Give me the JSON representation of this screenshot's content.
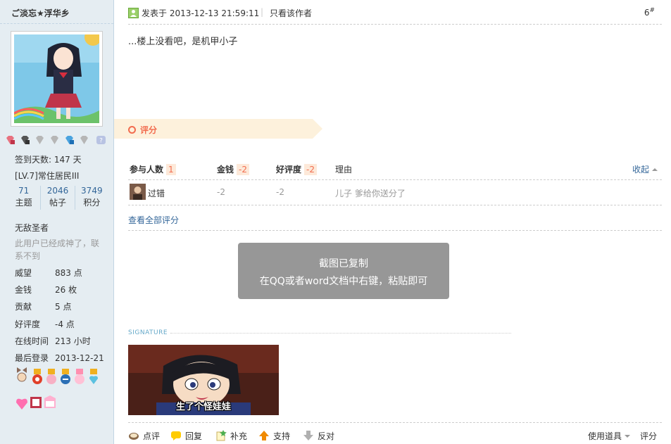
{
  "sidebar": {
    "username": "ご淡忘★浮华乡",
    "checkin": "签到天数: 147 天",
    "level": "[LV.7]常住居民III",
    "stats": [
      {
        "num": "71",
        "label": "主题"
      },
      {
        "num": "2046",
        "label": "帖子"
      },
      {
        "num": "3749",
        "label": "积分"
      }
    ],
    "title": "无敌圣者",
    "note": "此用户已经成神了，联系不到",
    "profile": [
      {
        "key": "威望",
        "value": "883 点"
      },
      {
        "key": "金钱",
        "value": "26 枚"
      },
      {
        "key": "贡献",
        "value": "5 点"
      },
      {
        "key": "好评度",
        "value": "-4 点"
      },
      {
        "key": "在线时间",
        "value": "213 小时"
      },
      {
        "key": "最后登录",
        "value": "2013-12-21"
      }
    ]
  },
  "post": {
    "posted_at": "发表于 2013-12-13 21:59:11",
    "only_author": "只看该作者",
    "floor": "6",
    "floor_mark": "#",
    "content": "...楼上没看吧，是机甲小子"
  },
  "rating": {
    "banner": "评分",
    "headers": {
      "participants": "参与人数",
      "participants_count": "1",
      "money": "金钱",
      "money_total": "-2",
      "reputation": "好评度",
      "reputation_total": "-2",
      "reason": "理由",
      "collapse": "收起"
    },
    "rows": [
      {
        "user": "过错",
        "money": "-2",
        "reputation": "-2",
        "reason": "儿子 爹给你送分了"
      }
    ],
    "view_all": "查看全部评分"
  },
  "toast": {
    "line1": "截图已复制",
    "line2": "在QQ或者word文档中右键，粘贴即可"
  },
  "signature": {
    "label": "SIGNATURE",
    "caption": "生了个怪娃娃"
  },
  "actions": {
    "comment": "点评",
    "reply": "回复",
    "supplement": "补充",
    "support": "支持",
    "oppose": "反对",
    "tools": "使用道具",
    "rate": "评分"
  },
  "colors": {
    "sidebar_bg": "#e5edf2",
    "link": "#336699",
    "rate_accent": "#f26c4f",
    "rate_banner": "#fdf1dc"
  }
}
